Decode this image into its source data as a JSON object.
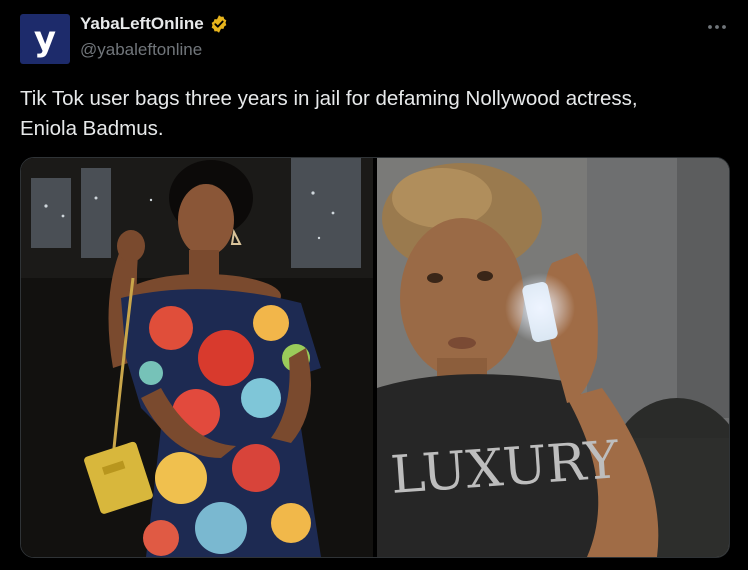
{
  "tweet": {
    "author": {
      "display_name": "YabaLeftOnline",
      "handle": "@yabaleftonline",
      "avatar_letter": "y",
      "avatar_color": "#1d2b6b",
      "verified_icon": "verified-gold-badge-icon",
      "verified_color": "#e7b41c"
    },
    "text": "Tik Tok user bags three years in jail for defaming Nollywood actress,\nEniola Badmus.",
    "more_icon": "more-options-icon",
    "media": {
      "left_image": "woman-in-floral-jumpsuit-photo",
      "right_image": "girl-on-phone-selfie-photo",
      "shirt_text": "LUXURY"
    }
  },
  "colors": {
    "background": "#000000",
    "text_primary": "#e7e9ea",
    "text_secondary": "#71767b",
    "border": "#2f3336"
  }
}
